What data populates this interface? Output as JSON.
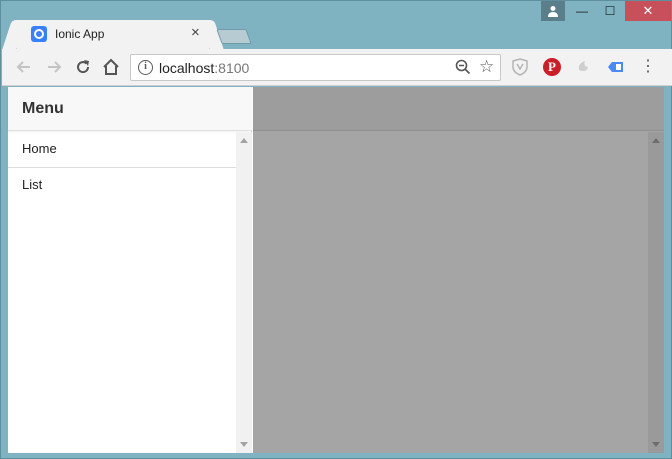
{
  "browser": {
    "tab_title": "Ionic App",
    "tab_close": "×",
    "url_host": "localhost",
    "url_port": ":8100",
    "window_controls": {
      "minimize": "—",
      "maximize": "☐",
      "close": "✕"
    },
    "menu_glyph": "⋮",
    "star_glyph": "☆",
    "info_glyph": "i",
    "pinterest_glyph": "P",
    "accent_color": "#3880ff"
  },
  "app": {
    "menu_title": "Menu",
    "menu_items": [
      {
        "label": "Home"
      },
      {
        "label": "List"
      }
    ]
  }
}
